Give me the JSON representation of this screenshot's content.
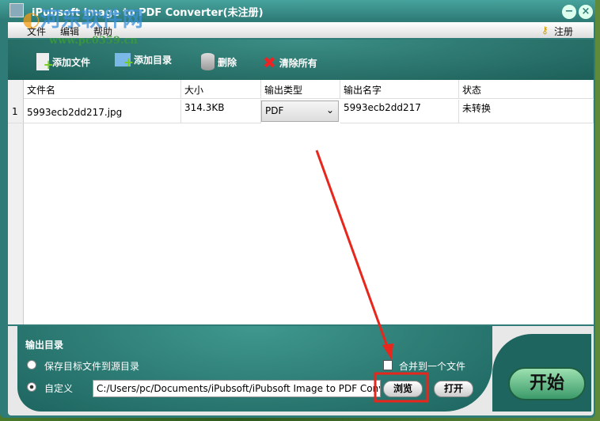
{
  "window": {
    "title": "iPubsoft Image to PDF Converter(未注册)",
    "minimize": "−",
    "close": "×"
  },
  "menu": {
    "file": "文件",
    "edit": "编辑",
    "help": "帮助",
    "register": "注册"
  },
  "toolbar": {
    "add_file": "添加文件",
    "add_folder": "添加目录",
    "delete": "删除",
    "clear_all": "清除所有"
  },
  "table": {
    "headers": [
      "文件名",
      "大小",
      "输出类型",
      "输出名字",
      "状态"
    ],
    "rows": [
      {
        "num": "1",
        "name": "5993ecb2dd217.jpg",
        "size": "314.3KB",
        "type": "PDF",
        "output": "5993ecb2dd217",
        "status": "未转换"
      }
    ]
  },
  "output": {
    "title": "输出目录",
    "option_source": "保存目标文件到源目录",
    "option_custom": "自定义",
    "path": "C:/Users/pc/Documents/iPubsoft/iPubsoft Image to PDF Conv",
    "merge": "合并到一个文件",
    "browse": "浏览",
    "open": "打开",
    "start": "开始"
  },
  "watermark": {
    "name": "河东软件网",
    "url": "www.pc0359.cn"
  }
}
